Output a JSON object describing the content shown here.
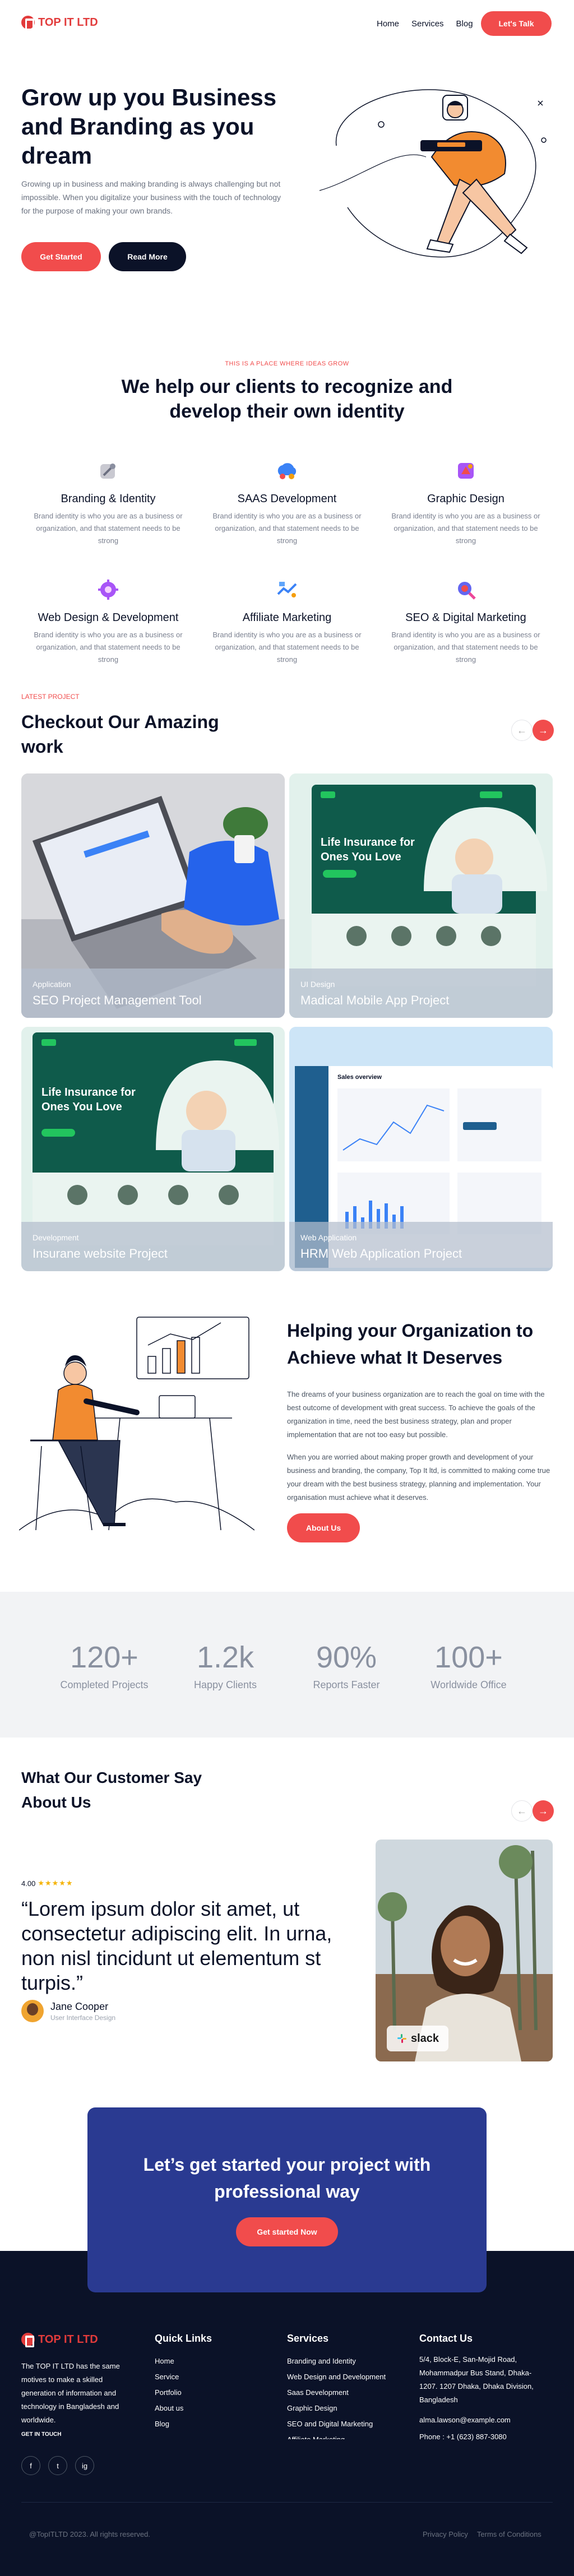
{
  "header": {
    "logo": "TOP IT LTD",
    "nav": [
      "Home",
      "Services",
      "Blog"
    ],
    "cta": "Let's Talk"
  },
  "hero": {
    "title": "Grow up you Business and Branding as you dream",
    "description": "Growing up in business and making branding is always challenging but not impossible. When you digitalize your business with the touch of technology for the purpose of making your own brands.",
    "primary_button": "Get Started",
    "secondary_button": "Read More"
  },
  "services": {
    "eyebrow": "THIS IS A PLACE WHERE IDEAS GROW",
    "title": "We help our clients to recognize and develop their own identity",
    "items": [
      {
        "title": "Branding & Identity",
        "desc": "Brand identity is who you are as a business or organization, and that statement needs to be strong",
        "icon": "branding-icon"
      },
      {
        "title": "SAAS Development",
        "desc": "Brand identity is who you are as a business or organization, and that statement needs to be strong",
        "icon": "saas-icon"
      },
      {
        "title": "Graphic Design",
        "desc": "Brand identity is who you are as a business or organization, and that statement needs to be strong",
        "icon": "graphic-design-icon"
      },
      {
        "title": "Web Design & Development",
        "desc": "Brand identity is who you are as a business or organization, and that statement needs to be strong",
        "icon": "web-design-icon"
      },
      {
        "title": "Affiliate Marketing",
        "desc": "Brand identity is who you are as a business or organization, and that statement needs to be strong",
        "icon": "affiliate-icon"
      },
      {
        "title": "SEO & Digital Marketing",
        "desc": "Brand identity is who you are as a business or organization, and that statement needs to be strong",
        "icon": "seo-icon"
      }
    ]
  },
  "portfolio": {
    "eyebrow": "LATEST PROJECT",
    "title": "Checkout Our Amazing work",
    "projects": [
      {
        "category": "Application",
        "name": "SEO Project Management Tool"
      },
      {
        "category": "UI Design",
        "name": "Madical Mobile App Project"
      },
      {
        "category": "Development",
        "name": "Insurane website Project"
      },
      {
        "category": "Web Application",
        "name": "HRM Web Application Project"
      }
    ],
    "mockup": {
      "headline": "Life Insurance for Ones You Love",
      "dashboard_title": "Sales overview"
    }
  },
  "organization": {
    "title": "Helping your Organization to Achieve what It Deserves",
    "p1": "The dreams of your business organization are to reach the goal on time with the best outcome of development with great success. To achieve the goals of the organization in time, need the best business strategy, plan and proper implementation that are not too easy but possible.",
    "p2": "When you are worried about making proper growth and development of your business and branding, the company, Top It ltd, is committed to making come true your dream with the best business strategy, planning and implementation. Your organisation must achieve what it deserves.",
    "button": "About Us"
  },
  "stats": [
    {
      "value": "120+",
      "label": "Completed Projects"
    },
    {
      "value": "1.2k",
      "label": "Happy Clients"
    },
    {
      "value": "90%",
      "label": "Reports Faster"
    },
    {
      "value": "100+",
      "label": "Worldwide Office"
    }
  ],
  "testimonials": {
    "title": "What Our Customer Say About Us",
    "rating_value": "4.00",
    "stars": "★★★★★",
    "quote": "“Lorem ipsum dolor sit amet, ut consectetur adipiscing elit. In urna, non nisl tincidunt ut elementum st turpis.”",
    "name": "Jane Cooper",
    "role": "User Interface Design",
    "company_badge": "slack"
  },
  "cta": {
    "title": "Let’s get started your project with professional way",
    "button": "Get started Now"
  },
  "footer": {
    "logo": "TOP IT LTD",
    "about": "The TOP IT LTD has the same motives to make a skilled generation of information and technology in Bangladesh and worldwide.",
    "get_in_touch": "GET IN TOUCH",
    "social": [
      "f",
      "t",
      "ig"
    ],
    "quick_links_title": "Quick Links",
    "quick_links": [
      "Home",
      "Service",
      "Portfolio",
      "About us",
      "Blog"
    ],
    "services_title": "Services",
    "services": [
      "Branding and Identity",
      "Web Design and Development",
      "Saas Development",
      "Graphic Design",
      "SEO and Digital Marketing",
      "Affiliate Marketing"
    ],
    "contact_title": "Contact Us",
    "address": "5/4, Block-E, San-Mojid Road, Mohammadpur Bus Stand, Dhaka-1207. 1207 Dhaka, Dhaka Division, Bangladesh",
    "email": "alma.lawson@example.com",
    "phone": "Phone : +1 (623) 887-3080",
    "copyright": "@TopITLTD 2023. All rights reserved.",
    "privacy": "Privacy Policy",
    "terms": "Terms of Conditions"
  },
  "colors": {
    "accent": "#f14c4c",
    "dark": "#0b1228",
    "cta_bg": "#2a3a91",
    "muted": "#6b7280"
  }
}
